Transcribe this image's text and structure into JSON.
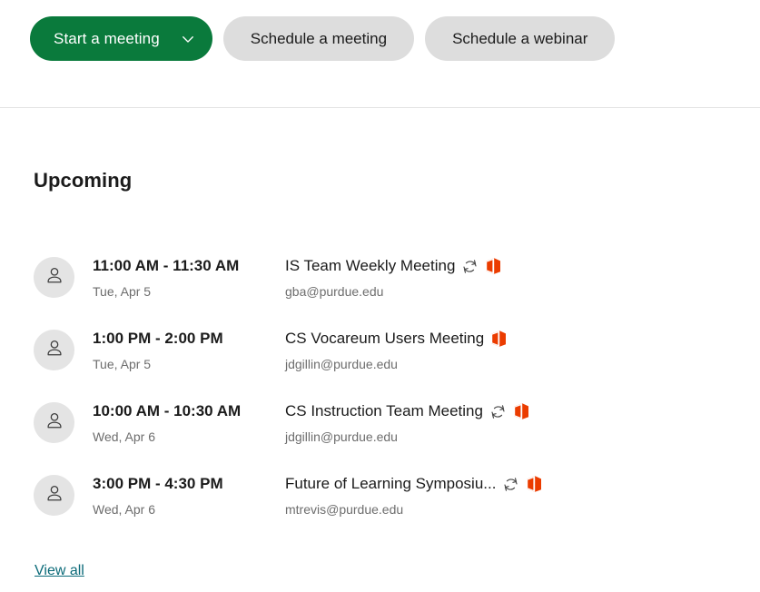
{
  "toolbar": {
    "start_meeting_label": "Start a meeting",
    "start_meeting_caret_icon": "chevron-down-icon",
    "schedule_meeting_label": "Schedule a meeting",
    "schedule_webinar_label": "Schedule a webinar",
    "primary_color": "#0a7a3c",
    "secondary_color": "#dddddd"
  },
  "upcoming": {
    "heading": "Upcoming",
    "view_all_label": "View all",
    "view_all_color": "#0a6a78",
    "meetings": [
      {
        "avatar_icon": "person-icon",
        "time": "11:00 AM - 11:30 AM",
        "date": "Tue, Apr 5",
        "title": "IS Team Weekly Meeting",
        "organizer": "gba@purdue.edu",
        "recurring": true,
        "recurring_icon": "recurring-icon",
        "provider_icon": "office-icon"
      },
      {
        "avatar_icon": "person-icon",
        "time": "1:00 PM - 2:00 PM",
        "date": "Tue, Apr 5",
        "title": "CS Vocareum Users Meeting",
        "organizer": "jdgillin@purdue.edu",
        "recurring": false,
        "recurring_icon": "recurring-icon",
        "provider_icon": "office-icon"
      },
      {
        "avatar_icon": "person-icon",
        "time": "10:00 AM - 10:30 AM",
        "date": "Wed, Apr 6",
        "title": "CS Instruction Team Meeting",
        "organizer": "jdgillin@purdue.edu",
        "recurring": true,
        "recurring_icon": "recurring-icon",
        "provider_icon": "office-icon"
      },
      {
        "avatar_icon": "person-icon",
        "time": "3:00 PM - 4:30 PM",
        "date": "Wed, Apr 6",
        "title": "Future of Learning Symposiu...",
        "organizer": "mtrevis@purdue.edu",
        "recurring": true,
        "recurring_icon": "recurring-icon",
        "provider_icon": "office-icon"
      }
    ]
  }
}
